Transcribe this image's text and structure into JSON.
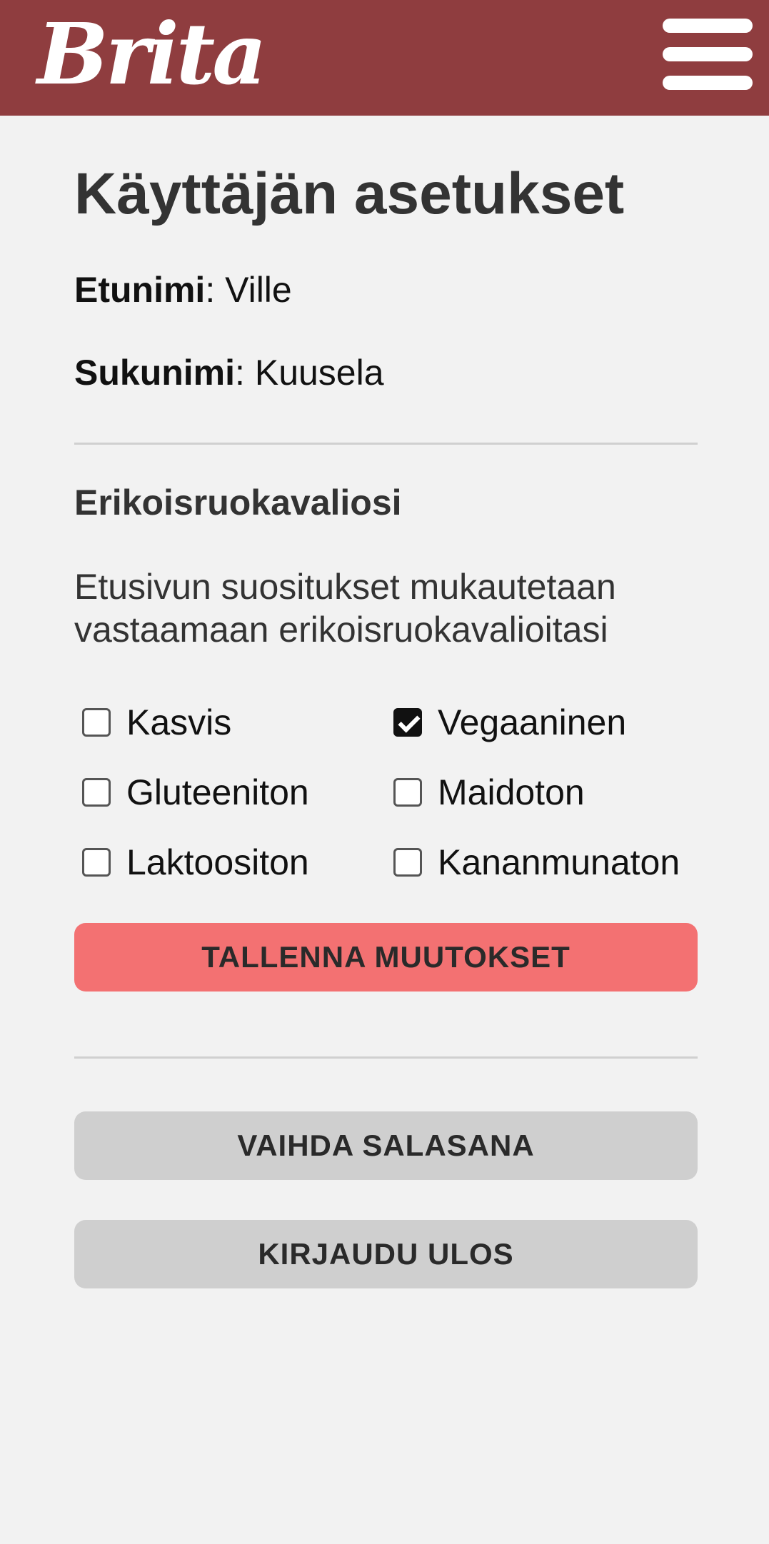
{
  "header": {
    "logo_text": "Brita",
    "menu_icon": "hamburger-menu-icon",
    "background_color": "#8f3d3f"
  },
  "page": {
    "title": "Käyttäjän asetukset"
  },
  "profile": {
    "first_name_label": "Etunimi",
    "first_name_value": "Ville",
    "last_name_label": "Sukunimi",
    "last_name_value": "Kuusela",
    "separator": ":"
  },
  "diet": {
    "title": "Erikoisruokavaliosi",
    "description": "Etusivun suositukset mukautetaan vastaamaan erikoisruokavalioitasi",
    "options": [
      {
        "label": "Kasvis",
        "checked": false
      },
      {
        "label": "Vegaaninen",
        "checked": true
      },
      {
        "label": "Gluteeniton",
        "checked": false
      },
      {
        "label": "Maidoton",
        "checked": false
      },
      {
        "label": "Laktoositon",
        "checked": false
      },
      {
        "label": "Kananmunaton",
        "checked": false
      }
    ]
  },
  "actions": {
    "save_label": "TALLENNA MUUTOKSET",
    "change_password_label": "VAIHDA SALASANA",
    "logout_label": "KIRJAUDU ULOS",
    "primary_color": "#f37172",
    "secondary_color": "#cfcfcf"
  }
}
